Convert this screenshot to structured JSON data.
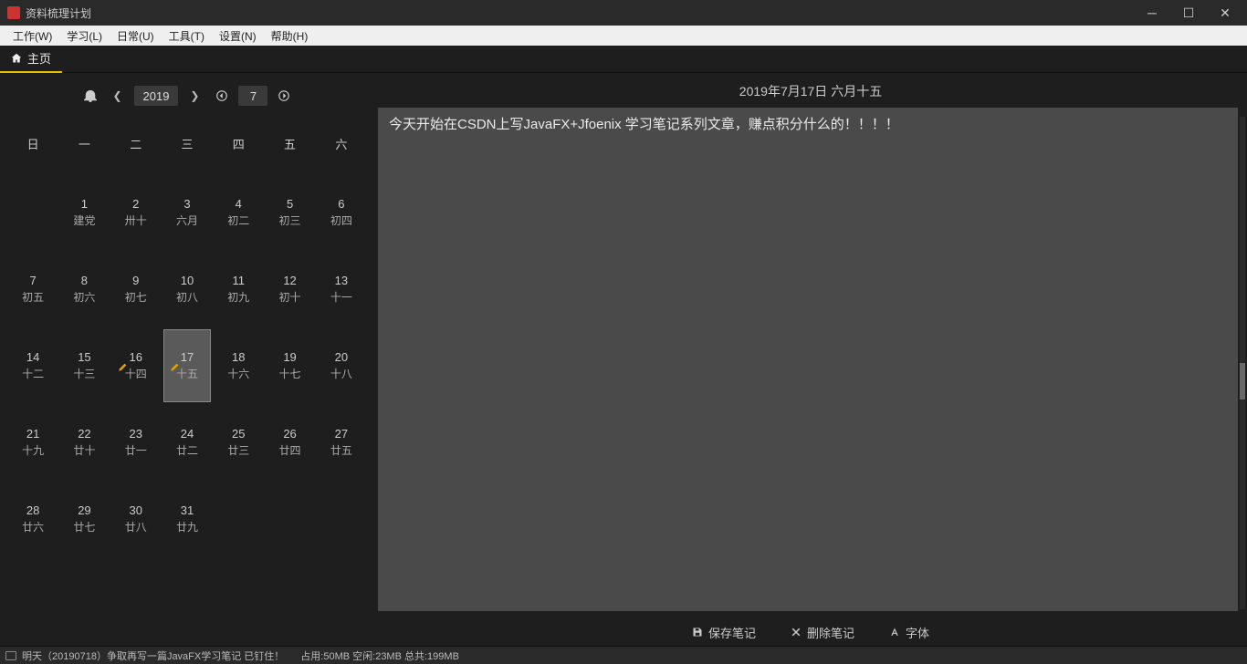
{
  "window": {
    "title": "资料梳理计划"
  },
  "menu": {
    "items": [
      "工作(W)",
      "学习(L)",
      "日常(U)",
      "工具(T)",
      "设置(N)",
      "帮助(H)"
    ]
  },
  "tab": {
    "label": "主页"
  },
  "calendar": {
    "year": "2019",
    "month": "7",
    "headerDate": "2019年7月17日 六月十五",
    "dow": [
      "日",
      "一",
      "二",
      "三",
      "四",
      "五",
      "六"
    ],
    "days": [
      {
        "n": "",
        "l": ""
      },
      {
        "n": "1",
        "l": "建党"
      },
      {
        "n": "2",
        "l": "卅十"
      },
      {
        "n": "3",
        "l": "六月"
      },
      {
        "n": "4",
        "l": "初二"
      },
      {
        "n": "5",
        "l": "初三"
      },
      {
        "n": "6",
        "l": "初四"
      },
      {
        "n": "7",
        "l": "初五"
      },
      {
        "n": "8",
        "l": "初六"
      },
      {
        "n": "9",
        "l": "初七"
      },
      {
        "n": "10",
        "l": "初八"
      },
      {
        "n": "11",
        "l": "初九"
      },
      {
        "n": "12",
        "l": "初十"
      },
      {
        "n": "13",
        "l": "十一"
      },
      {
        "n": "14",
        "l": "十二"
      },
      {
        "n": "15",
        "l": "十三"
      },
      {
        "n": "16",
        "l": "十四",
        "note": true
      },
      {
        "n": "17",
        "l": "十五",
        "note": true,
        "selected": true
      },
      {
        "n": "18",
        "l": "十六"
      },
      {
        "n": "19",
        "l": "十七"
      },
      {
        "n": "20",
        "l": "十八"
      },
      {
        "n": "21",
        "l": "十九"
      },
      {
        "n": "22",
        "l": "廿十"
      },
      {
        "n": "23",
        "l": "廿一"
      },
      {
        "n": "24",
        "l": "廿二"
      },
      {
        "n": "25",
        "l": "廿三"
      },
      {
        "n": "26",
        "l": "廿四"
      },
      {
        "n": "27",
        "l": "廿五"
      },
      {
        "n": "28",
        "l": "廿六"
      },
      {
        "n": "29",
        "l": "廿七"
      },
      {
        "n": "30",
        "l": "廿八"
      },
      {
        "n": "31",
        "l": "廿九"
      },
      {
        "n": "",
        "l": ""
      },
      {
        "n": "",
        "l": ""
      },
      {
        "n": "",
        "l": ""
      }
    ]
  },
  "editor": {
    "content": "今天开始在CSDN上写JavaFX+Jfoenix 学习笔记系列文章，赚点积分什么的！！！！"
  },
  "toolbar": {
    "save": "保存笔记",
    "delete": "删除笔记",
    "font": "字体"
  },
  "status": {
    "text": "明天（20190718）争取再写一篇JavaFX学习笔记 已钉住！",
    "mem": "占用:50MB 空闲:23MB 总共:199MB"
  }
}
